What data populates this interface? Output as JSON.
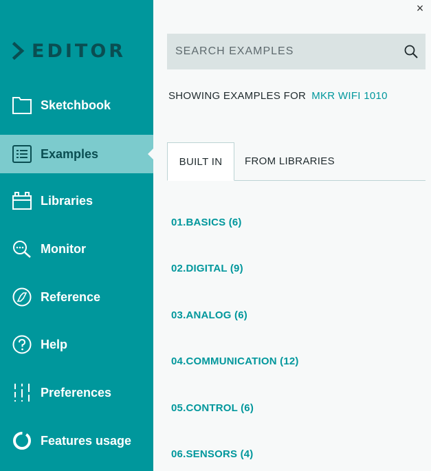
{
  "app": {
    "logo_text": "EDITOR"
  },
  "sidebar": {
    "items": [
      {
        "label": "Sketchbook",
        "icon": "folder-icon"
      },
      {
        "label": "Examples",
        "icon": "list-icon",
        "active": true
      },
      {
        "label": "Libraries",
        "icon": "library-icon"
      },
      {
        "label": "Monitor",
        "icon": "monitor-icon"
      },
      {
        "label": "Reference",
        "icon": "compass-icon"
      },
      {
        "label": "Help",
        "icon": "help-icon"
      },
      {
        "label": "Preferences",
        "icon": "sliders-icon"
      },
      {
        "label": "Features usage",
        "icon": "usage-ring-icon"
      }
    ]
  },
  "panel": {
    "close_glyph": "×",
    "search": {
      "placeholder": "SEARCH EXAMPLES",
      "value": ""
    },
    "showing_label": "SHOWING EXAMPLES FOR",
    "board_name": "MKR WIFI 1010",
    "tabs": [
      {
        "label": "BUILT IN",
        "active": true
      },
      {
        "label": "FROM LIBRARIES",
        "active": false
      }
    ],
    "examples": [
      {
        "label": "01.BASICS (6)"
      },
      {
        "label": "02.DIGITAL (9)"
      },
      {
        "label": "03.ANALOG (6)"
      },
      {
        "label": "04.COMMUNICATION (12)"
      },
      {
        "label": "05.CONTROL (6)"
      },
      {
        "label": "06.SENSORS (4)"
      }
    ]
  },
  "colors": {
    "sidebar_bg": "#00979c",
    "active_item_bg": "#7ccbcd",
    "accent": "#00979c",
    "logo": "#0a4e52"
  }
}
